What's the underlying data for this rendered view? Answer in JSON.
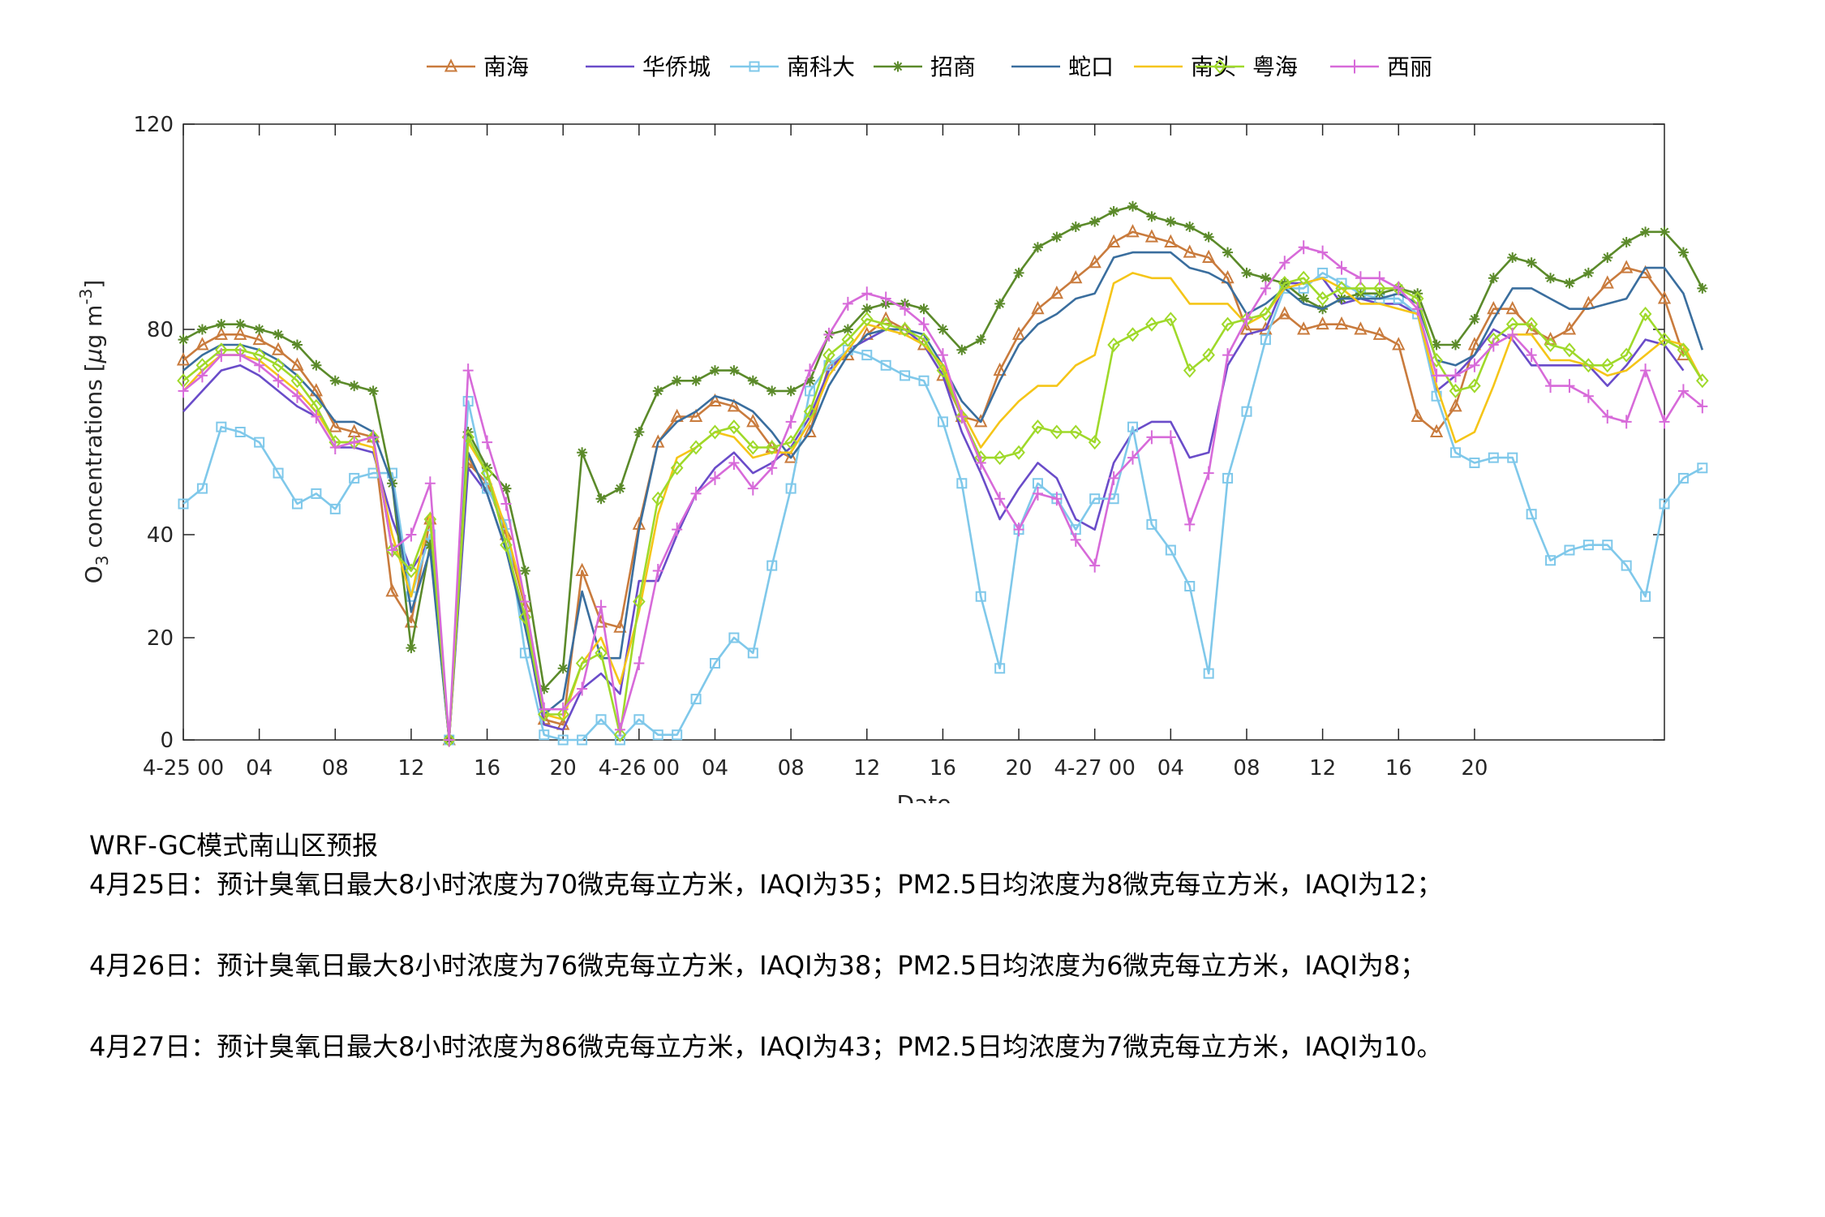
{
  "chart_data": {
    "type": "line",
    "xlabel": "Date",
    "ylabel": "O3 concentrations [μg m-3]",
    "ylabel_parts": {
      "o": "O",
      "sub": "3",
      "rest": " concentrations [",
      "mu": "μ",
      "g": "g m",
      "sup": "-3",
      "end": "]"
    },
    "ylim": [
      0,
      120
    ],
    "yticks": [
      0,
      20,
      40,
      80,
      120
    ],
    "xlim": [
      0,
      78
    ],
    "xticks": [
      {
        "x": 0,
        "label": "4-25 00"
      },
      {
        "x": 4,
        "label": "04"
      },
      {
        "x": 8,
        "label": "08"
      },
      {
        "x": 12,
        "label": "12"
      },
      {
        "x": 16,
        "label": "16"
      },
      {
        "x": 20,
        "label": "20"
      },
      {
        "x": 24,
        "label": "4-26 00"
      },
      {
        "x": 28,
        "label": "04"
      },
      {
        "x": 32,
        "label": "08"
      },
      {
        "x": 36,
        "label": "12"
      },
      {
        "x": 40,
        "label": "16"
      },
      {
        "x": 44,
        "label": "20"
      },
      {
        "x": 48,
        "label": "4-27 00"
      },
      {
        "x": 52,
        "label": "04"
      },
      {
        "x": 56,
        "label": "08"
      },
      {
        "x": 60,
        "label": "12"
      },
      {
        "x": 64,
        "label": "16"
      },
      {
        "x": 68,
        "label": "20"
      }
    ],
    "legend_position": "top",
    "series": [
      {
        "name": "南海",
        "color": "#c97b3d",
        "marker": "triangle",
        "values": [
          74,
          77,
          79,
          79,
          78,
          76,
          73,
          68,
          61,
          60,
          59,
          29,
          23,
          43,
          0,
          54,
          50,
          40,
          26,
          4,
          3,
          33,
          23,
          22,
          42,
          58,
          63,
          63,
          66,
          65,
          62,
          57,
          55,
          60,
          73,
          75,
          79,
          82,
          80,
          77,
          71,
          63,
          62,
          72,
          79,
          84,
          87,
          90,
          93,
          97,
          99,
          98,
          97,
          95,
          94,
          90,
          80,
          80,
          83,
          80,
          81,
          81,
          80,
          79,
          77,
          63,
          60,
          65,
          77,
          84,
          84,
          80,
          78,
          80,
          85,
          89,
          92,
          91,
          86,
          75
        ]
      },
      {
        "name": "华侨城",
        "color": "#6a4cc9",
        "marker": "none",
        "values": [
          64,
          68,
          72,
          73,
          71,
          68,
          65,
          63,
          57,
          57,
          56,
          43,
          33,
          39,
          0,
          53,
          48,
          37,
          23,
          3,
          2,
          10,
          13,
          9,
          31,
          31,
          40,
          48,
          53,
          56,
          52,
          54,
          57,
          63,
          72,
          76,
          78,
          80,
          80,
          77,
          71,
          60,
          52,
          43,
          49,
          54,
          51,
          43,
          41,
          54,
          60,
          62,
          62,
          55,
          56,
          73,
          79,
          80,
          89,
          89,
          90,
          85,
          86,
          85,
          85,
          83,
          68,
          71,
          75,
          80,
          78,
          73,
          73,
          73,
          73,
          69,
          73,
          78,
          77,
          72
        ]
      },
      {
        "name": "南科大",
        "color": "#7fc8ea",
        "marker": "square",
        "values": [
          46,
          49,
          61,
          60,
          58,
          52,
          46,
          48,
          45,
          51,
          52,
          52,
          28,
          40,
          0,
          66,
          49,
          42,
          17,
          1,
          0,
          0,
          4,
          0,
          4,
          1,
          1,
          8,
          15,
          20,
          17,
          34,
          49,
          68,
          73,
          76,
          75,
          73,
          71,
          70,
          62,
          50,
          28,
          14,
          41,
          50,
          47,
          41,
          47,
          47,
          61,
          42,
          37,
          30,
          13,
          51,
          64,
          78,
          88,
          88,
          91,
          89,
          87,
          86,
          86,
          83,
          67,
          56,
          54,
          55,
          55,
          44,
          35,
          37,
          38,
          38,
          34,
          28,
          46,
          51,
          53
        ]
      },
      {
        "name": "招商",
        "color": "#5b8a2a",
        "marker": "star",
        "values": [
          78,
          80,
          81,
          81,
          80,
          79,
          77,
          73,
          70,
          69,
          68,
          50,
          18,
          38,
          0,
          60,
          53,
          49,
          33,
          10,
          14,
          56,
          47,
          49,
          60,
          68,
          70,
          70,
          72,
          72,
          70,
          68,
          68,
          70,
          79,
          80,
          84,
          85,
          85,
          84,
          80,
          76,
          78,
          85,
          91,
          96,
          98,
          100,
          101,
          103,
          104,
          102,
          101,
          100,
          98,
          95,
          91,
          90,
          89,
          86,
          84,
          86,
          87,
          87,
          88,
          87,
          77,
          77,
          82,
          90,
          94,
          93,
          90,
          89,
          91,
          94,
          97,
          99,
          99,
          95,
          88
        ]
      },
      {
        "name": "蛇口",
        "color": "#3a6e9e",
        "marker": "none",
        "values": [
          72,
          75,
          77,
          77,
          76,
          74,
          71,
          67,
          62,
          62,
          60,
          50,
          25,
          37,
          0,
          56,
          48,
          37,
          22,
          5,
          8,
          29,
          16,
          16,
          41,
          58,
          62,
          64,
          67,
          66,
          64,
          60,
          55,
          60,
          69,
          75,
          79,
          80,
          80,
          79,
          73,
          66,
          62,
          70,
          77,
          81,
          83,
          86,
          87,
          94,
          95,
          95,
          95,
          92,
          91,
          89,
          83,
          85,
          88,
          85,
          84,
          86,
          86,
          86,
          87,
          85,
          74,
          73,
          75,
          82,
          88,
          88,
          86,
          84,
          84,
          85,
          86,
          92,
          92,
          87,
          76
        ]
      },
      {
        "name": "南头",
        "color": "#f5c518",
        "marker": "none",
        "values": [
          68,
          72,
          75,
          75,
          74,
          71,
          68,
          64,
          58,
          58,
          57,
          40,
          28,
          44,
          0,
          58,
          52,
          41,
          27,
          5,
          4,
          15,
          20,
          11,
          25,
          44,
          55,
          57,
          60,
          59,
          55,
          56,
          56,
          62,
          71,
          76,
          81,
          80,
          79,
          77,
          73,
          64,
          57,
          62,
          66,
          69,
          69,
          73,
          75,
          89,
          91,
          90,
          90,
          85,
          85,
          85,
          81,
          83,
          88,
          89,
          90,
          88,
          85,
          85,
          84,
          83,
          69,
          58,
          60,
          69,
          79,
          79,
          74,
          74,
          73,
          71,
          72,
          75,
          78,
          77,
          70
        ]
      },
      {
        "name": "粤海",
        "color": "#9fd92a",
        "marker": "diamond",
        "values": [
          70,
          73,
          76,
          76,
          75,
          73,
          70,
          65,
          58,
          58,
          59,
          37,
          33,
          43,
          0,
          59,
          52,
          38,
          24,
          5,
          5,
          15,
          17,
          1,
          27,
          47,
          53,
          57,
          60,
          61,
          57,
          57,
          58,
          64,
          75,
          78,
          82,
          81,
          80,
          78,
          72,
          63,
          55,
          55,
          56,
          61,
          60,
          60,
          58,
          77,
          79,
          81,
          82,
          72,
          75,
          81,
          82,
          83,
          89,
          90,
          86,
          88,
          88,
          88,
          88,
          86,
          74,
          68,
          69,
          78,
          81,
          81,
          77,
          76,
          73,
          73,
          75,
          83,
          78,
          76,
          70
        ]
      },
      {
        "name": "西丽",
        "color": "#d76ad9",
        "marker": "plus",
        "values": [
          68,
          71,
          75,
          75,
          73,
          70,
          67,
          63,
          57,
          58,
          59,
          37,
          40,
          50,
          0,
          72,
          58,
          46,
          27,
          6,
          6,
          10,
          26,
          2,
          15,
          33,
          41,
          48,
          51,
          54,
          49,
          53,
          62,
          72,
          79,
          85,
          87,
          86,
          84,
          81,
          75,
          63,
          54,
          47,
          41,
          48,
          47,
          39,
          34,
          51,
          55,
          59,
          59,
          42,
          52,
          75,
          82,
          88,
          93,
          96,
          95,
          92,
          90,
          90,
          88,
          84,
          71,
          71,
          73,
          77,
          79,
          75,
          69,
          69,
          67,
          63,
          62,
          72,
          62,
          68,
          65
        ]
      }
    ]
  },
  "forecast": {
    "title": "WRF-GC模式南山区预报",
    "lines": [
      "4月25日：预计臭氧日最大8小时浓度为70微克每立方米，IAQI为35；PM2.5日均浓度为8微克每立方米，IAQI为12；",
      "4月26日：预计臭氧日最大8小时浓度为76微克每立方米，IAQI为38；PM2.5日均浓度为6微克每立方米，IAQI为8；",
      "4月27日：预计臭氧日最大8小时浓度为86微克每立方米，IAQI为43；PM2.5日均浓度为7微克每立方米，IAQI为10。"
    ]
  }
}
